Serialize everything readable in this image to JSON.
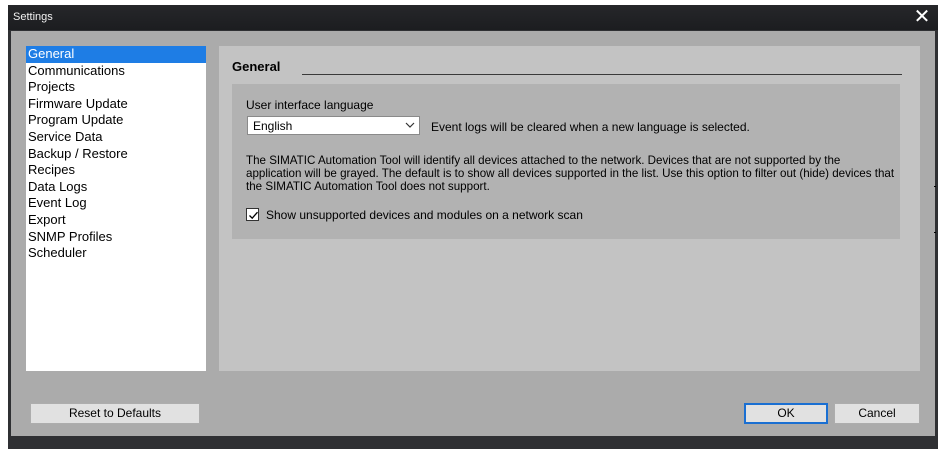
{
  "window": {
    "title": "Settings",
    "close_glyph": "✕"
  },
  "sidebar": {
    "items": [
      {
        "label": "General",
        "selected": true
      },
      {
        "label": "Communications"
      },
      {
        "label": "Projects"
      },
      {
        "label": "Firmware Update"
      },
      {
        "label": "Program Update"
      },
      {
        "label": "Service Data"
      },
      {
        "label": "Backup / Restore"
      },
      {
        "label": "Recipes"
      },
      {
        "label": "Data Logs"
      },
      {
        "label": "Event Log"
      },
      {
        "label": "Export"
      },
      {
        "label": "SNMP Profiles"
      },
      {
        "label": "Scheduler"
      }
    ]
  },
  "main": {
    "section_title": "General",
    "language": {
      "label": "User interface language",
      "selected": "English",
      "note": "Event logs will be cleared when a new language is selected."
    },
    "description": "The SIMATIC Automation Tool will identify all devices attached to the network.  Devices that are not supported by the application will be grayed.  The default is to show all devices supported in the list.  Use this option to filter out (hide) devices that the SIMATIC Automation Tool does not support.",
    "show_unsupported": {
      "label": "Show unsupported devices and modules on a network scan",
      "checked": true
    }
  },
  "footer": {
    "reset_label": "Reset to Defaults",
    "ok_label": "OK",
    "cancel_label": "Cancel"
  },
  "colors": {
    "selection": "#1e7de5",
    "default_button_border": "#1a6fd2",
    "titlebar": "#1f2023"
  }
}
